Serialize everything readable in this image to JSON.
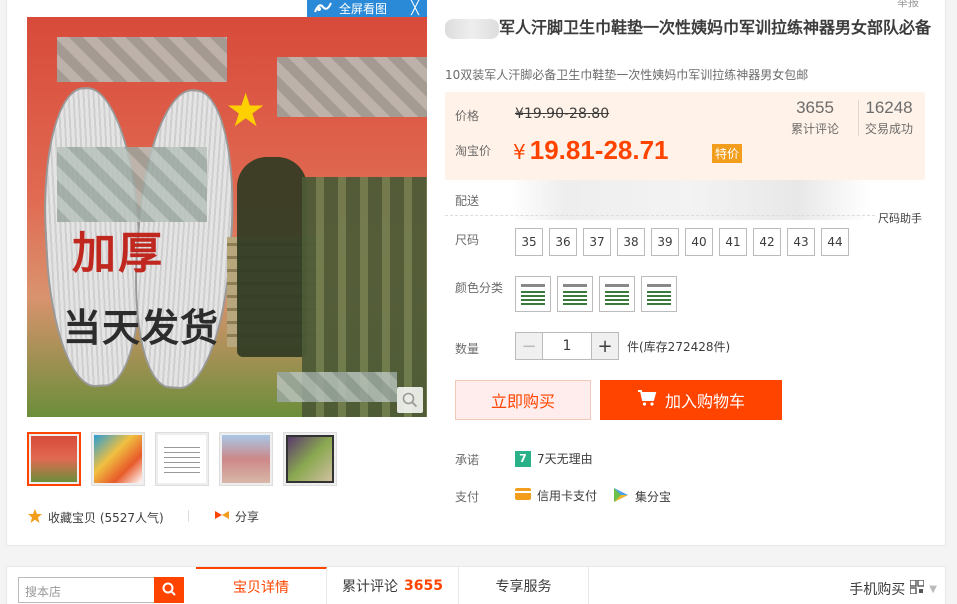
{
  "viewer": {
    "fullscreen_label": "全屏看图",
    "close_glyph": "╳"
  },
  "report_label": "举报",
  "gallery": {
    "main_text_1": "加厚",
    "main_text_2": "当天发货"
  },
  "product": {
    "title_rest": "军人汗脚卫生巾鞋垫一次性姨妈巾军训拉练神器男女部队必备",
    "subtitle": "10双装军人汗脚必备卫生巾鞋垫一次性姨妈巾军训拉练神器男女包邮"
  },
  "price": {
    "label_price": "价格",
    "original": "¥19.90-28.80",
    "label_taobao": "淘宝价",
    "currency": "¥",
    "current": "19.81-28.71",
    "promo_tag": "特价",
    "reviews_count": "3655",
    "reviews_label": "累计评论",
    "sales_count": "16248",
    "sales_label": "交易成功"
  },
  "shipping": {
    "label": "配送"
  },
  "size": {
    "label": "尺码",
    "help": "尺码助手",
    "options": [
      "35",
      "36",
      "37",
      "38",
      "39",
      "40",
      "41",
      "42",
      "43",
      "44"
    ]
  },
  "color": {
    "label": "颜色分类"
  },
  "quantity": {
    "label": "数量",
    "minus": "−",
    "value": "1",
    "plus": "+",
    "stock": "件(库存272428件)"
  },
  "actions": {
    "buy_now": "立即购买",
    "add_cart": "加入购物车"
  },
  "promise": {
    "label": "承诺",
    "badge": "7",
    "text": "7天无理由"
  },
  "payment": {
    "label": "支付",
    "credit": "信用卡支付",
    "points": "集分宝"
  },
  "favorite": {
    "text": "收藏宝贝 (5527人气)"
  },
  "share": {
    "text": "分享"
  },
  "bottom": {
    "search_placeholder": "搜本店",
    "tab_detail": "宝贝详情",
    "tab_reviews": "累计评论",
    "tab_reviews_count": "3655",
    "tab_service": "专享服务",
    "mobile_buy": "手机购买"
  },
  "colors": {
    "accent": "#ff4400",
    "price_bg": "#fff2e8",
    "promo": "#f29d1c"
  }
}
